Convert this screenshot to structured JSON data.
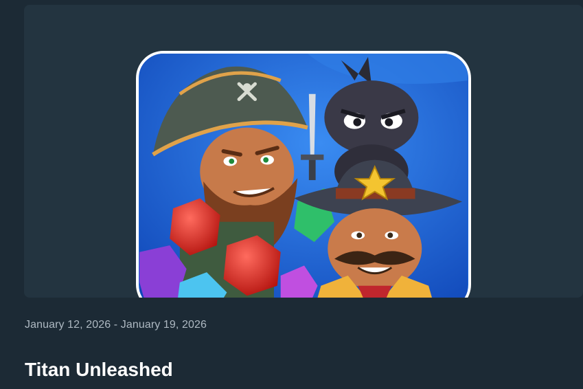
{
  "card": {
    "image_name": "titan-unleashed-app-icon",
    "date_range": "January 12, 2026 - January 19, 2026",
    "title": "Titan Unleashed"
  },
  "colors": {
    "page_background": "#1c2a35",
    "media_background": "#233440",
    "date_text": "#aeb9c2",
    "title_text": "#ffffff"
  }
}
